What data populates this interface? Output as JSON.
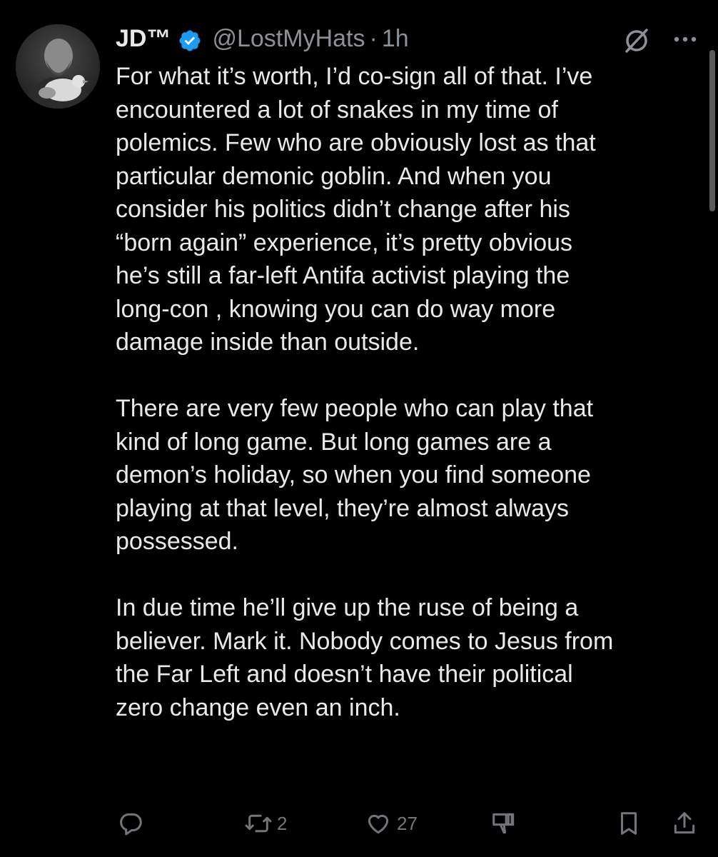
{
  "tweet": {
    "display_name": "JD™",
    "handle": "@LostMyHats",
    "separator": "·",
    "time": "1h",
    "paragraphs": [
      "For what it’s worth, I’d co-sign all of that. I’ve\nencountered a lot of snakes in my time of\npolemics. Few who are obviously lost as that\nparticular demonic goblin. And when you\nconsider his politics didn’t change after his\n“born again” experience, it’s pretty obvious\nhe’s still a far-left Antifa activist playing the\nlong-con , knowing you can do way more\ndamage inside than outside.",
      "There are very few people who can play that\nkind of long game. But long games are a\ndemon’s holiday, so when you find someone\nplaying at that level, they’re almost always\npossessed.",
      "In due time he’ll give up the ruse of being a\nbeliever. Mark it. Nobody comes to Jesus from\nthe Far Left and doesn’t have their political\nzero change even an inch."
    ],
    "actions": {
      "reply_count": "",
      "retweet_count": "2",
      "like_count": "27"
    }
  },
  "icons": {
    "verified": "verified-badge-icon",
    "grok": "grok-icon",
    "more": "more-icon",
    "reply": "reply-icon",
    "retweet": "retweet-icon",
    "like": "heart-icon",
    "views": "views-icon",
    "bookmark": "bookmark-icon",
    "share": "share-icon"
  },
  "colors": {
    "background": "#000000",
    "text": "#e7e9ea",
    "secondary_text": "#8b9197",
    "verified_blue": "#1d9bf0"
  }
}
